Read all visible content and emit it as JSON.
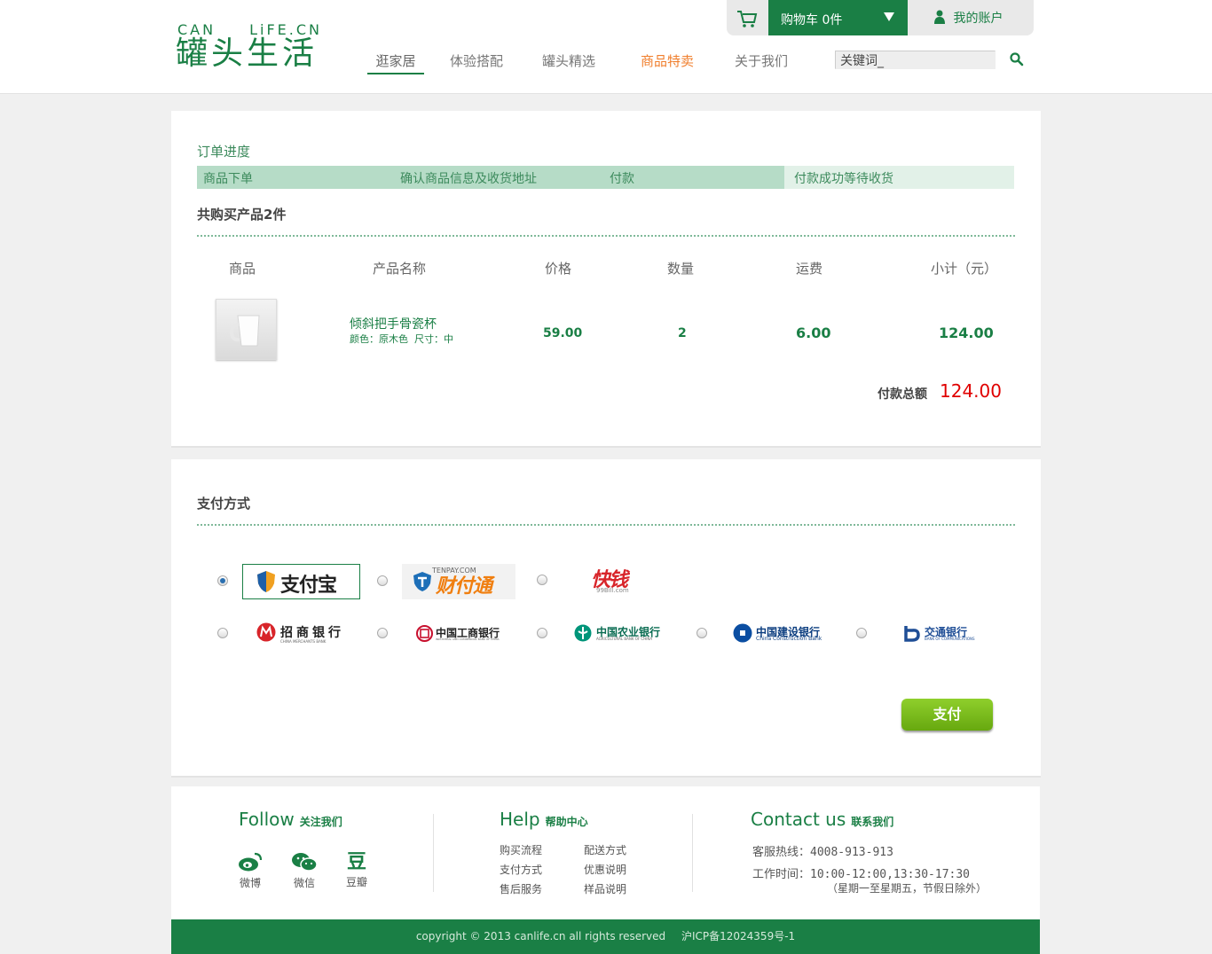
{
  "header": {
    "logo_top_left": "CAN",
    "logo_top_right": "LiFE.CN",
    "logo_main": "罐头生活",
    "nav": [
      "逛家居",
      "体验搭配",
      "罐头精选",
      "商品特卖",
      "关于我们"
    ],
    "search_value": "关键词_",
    "cart_label": "购物车 0件",
    "account_label": "我的账户"
  },
  "order": {
    "progress_title": "订单进度",
    "steps": [
      "商品下单",
      "确认商品信息及收货地址",
      "付款",
      "付款成功等待收货"
    ],
    "count_label": "共购买产品2件",
    "columns": [
      "商品",
      "产品名称",
      "价格",
      "数量",
      "运费",
      "小计（元）"
    ],
    "item": {
      "name": "倾斜把手骨瓷杯",
      "attrs": "颜色：原木色  尺寸：中",
      "price": "59.00",
      "qty": "2",
      "shipping": "6.00",
      "subtotal": "124.00"
    },
    "total_label": "付款总额",
    "total_value": "124.00"
  },
  "payment": {
    "title": "支付方式",
    "methods": [
      "支付宝",
      "财付通",
      "快钱",
      "招商银行",
      "中国工商银行",
      "中国农业银行",
      "中国建设银行",
      "交通银行"
    ],
    "method_sub": {
      "tenpay": "TENPAY.COM",
      "99bill": "99Bill.com",
      "cmb": "CHINA MERCHANTS BANK",
      "icbc": "INDUSTRIAL AND COMMERCIAL BANK OF CHINA",
      "abc": "AGRICULTURAL BANK OF CHINA",
      "ccb": "China Construction Bank",
      "bocom": "BANK OF COMMUNICATIONS"
    },
    "selected": "支付宝",
    "pay_button": "支付"
  },
  "footer": {
    "follow_title": "Follow",
    "follow_sub": "关注我们",
    "social": [
      "微博",
      "微信",
      "豆瓣"
    ],
    "douban_glyph": "豆",
    "help_title": "Help",
    "help_sub": "帮助中心",
    "help_links": [
      "购买流程",
      "配送方式",
      "支付方式",
      "优惠说明",
      "售后服务",
      "样品说明"
    ],
    "contact_title": "Contact us",
    "contact_sub": "联系我们",
    "hotline": "客服热线：4008-913-913",
    "hours": "工作时间：10:00-12:00,13:30-17:30",
    "hours_note": "（星期一至星期五，节假日除外）",
    "copyright": "copyright © 2013 canlife.cn all rights reserved",
    "icp": "沪ICP备12024359号-1"
  },
  "colors": {
    "brand": "#1a7f45",
    "promo": "#f07f2e",
    "total": "#e00000"
  }
}
